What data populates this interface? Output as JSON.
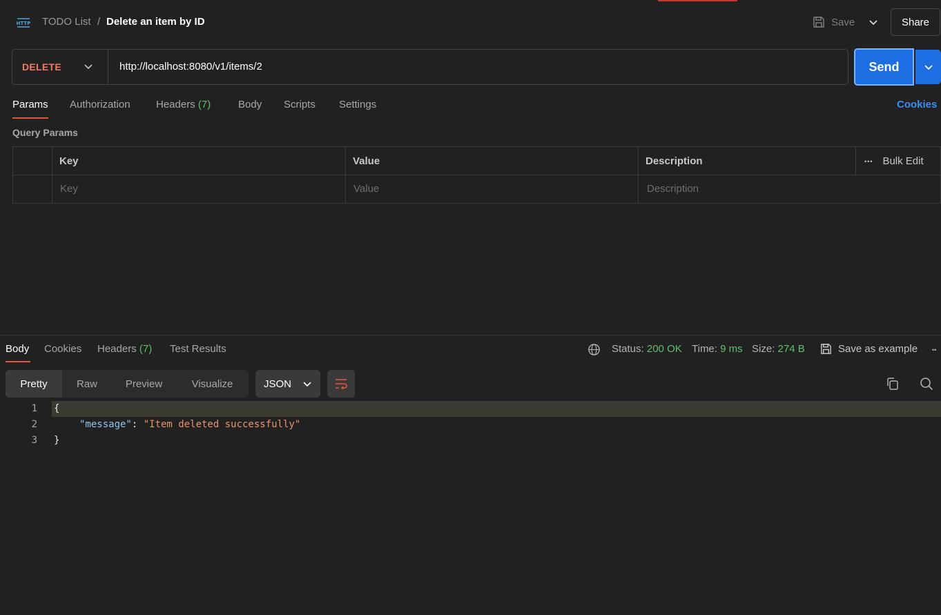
{
  "header": {
    "http_icon_label": "HTTP",
    "breadcrumb_parent": "TODO List",
    "breadcrumb_separator": "/",
    "breadcrumb_current": "Delete an item by ID",
    "save_label": "Save",
    "share_label": "Share"
  },
  "request": {
    "method": "DELETE",
    "url": "http://localhost:8080/v1/items/2",
    "send_label": "Send",
    "tabs": [
      {
        "label": "Params",
        "count": ""
      },
      {
        "label": "Authorization",
        "count": ""
      },
      {
        "label": "Headers",
        "count": "(7)"
      },
      {
        "label": "Body",
        "count": ""
      },
      {
        "label": "Scripts",
        "count": ""
      },
      {
        "label": "Settings",
        "count": ""
      }
    ],
    "active_tab": "Params",
    "cookies_label": "Cookies",
    "query_params_label": "Query Params",
    "params_table": {
      "headers": [
        "Key",
        "Value",
        "Description"
      ],
      "placeholders": [
        "Key",
        "Value",
        "Description"
      ],
      "bulk_edit_label": "Bulk Edit",
      "more_label": "•••"
    }
  },
  "response": {
    "tabs": [
      {
        "label": "Body",
        "count": ""
      },
      {
        "label": "Cookies",
        "count": ""
      },
      {
        "label": "Headers",
        "count": "(7)"
      },
      {
        "label": "Test Results",
        "count": ""
      }
    ],
    "active_tab": "Body",
    "status_label": "Status:",
    "status_value": "200 OK",
    "time_label": "Time:",
    "time_value": "9 ms",
    "size_label": "Size:",
    "size_value": "274 B",
    "save_example_label": "Save as example",
    "more_label": "••",
    "formats": [
      "Pretty",
      "Raw",
      "Preview",
      "Visualize"
    ],
    "active_format": "Pretty",
    "language": "JSON",
    "line_numbers": [
      "1",
      "2",
      "3"
    ],
    "body": {
      "open_brace": "{",
      "key": "\"message\"",
      "colon": ": ",
      "value": "\"Item deleted successfully\"",
      "close_brace": "}"
    }
  },
  "colors": {
    "background": "#212121",
    "method_delete": "#f07b65",
    "send_button": "#1d6ee3",
    "active_tab_underline": "#e2583e",
    "success_green": "#5fbf6e",
    "link_blue": "#3d8ff4"
  },
  "icons": {
    "http": "http-icon",
    "save": "floppy-disk-icon",
    "caret": "chevron-down-icon",
    "globe": "globe-icon",
    "wrap": "wrap-lines-icon",
    "copy": "copy-icon",
    "search": "search-icon"
  }
}
